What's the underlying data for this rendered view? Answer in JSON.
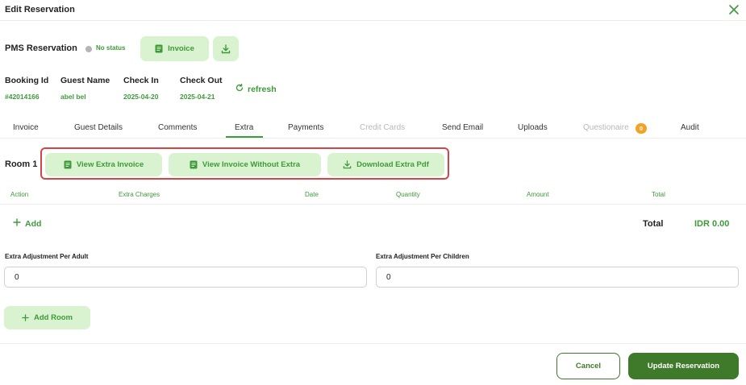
{
  "dialog": {
    "title": "Edit Reservation"
  },
  "reservation": {
    "title": "PMS Reservation",
    "status": "No status",
    "invoice_label": "Invoice",
    "booking_id_label": "Booking Id",
    "booking_id": "#42014166",
    "guest_name_label": "Guest Name",
    "guest_name": "abel bel",
    "check_in_label": "Check In",
    "check_in": "2025-04-20",
    "check_out_label": "Check Out",
    "check_out": "2025-04-21",
    "refresh_label": "refresh"
  },
  "tabs": [
    {
      "label": "Invoice"
    },
    {
      "label": "Guest Details"
    },
    {
      "label": "Comments"
    },
    {
      "label": "Extra",
      "active": true
    },
    {
      "label": "Payments"
    },
    {
      "label": "Credit Cards",
      "disabled": true
    },
    {
      "label": "Send Email"
    },
    {
      "label": "Uploads"
    },
    {
      "label": "Questionaire",
      "disabled": true,
      "badge": "0"
    },
    {
      "label": "Audit"
    }
  ],
  "room": {
    "label": "Room 1",
    "actions": {
      "view_extra_invoice": "View Extra Invoice",
      "view_invoice_without_extra": "View Invoice Without Extra",
      "download_extra_pdf": "Download Extra Pdf"
    },
    "table_headers": [
      "Action",
      "Extra Charges",
      "Date",
      "Quantity",
      "Amount",
      "Total"
    ],
    "add_label": "Add",
    "total_label": "Total",
    "total_value": "IDR 0.00",
    "adjust_adult_label": "Extra Adjustment Per Adult",
    "adjust_adult_value": "0",
    "adjust_children_label": "Extra Adjustment Per Children",
    "adjust_children_value": "0"
  },
  "add_room_label": "Add Room",
  "footer": {
    "cancel_label": "Cancel",
    "update_label": "Update Reservation"
  },
  "colors": {
    "accent": "#3f9a3b",
    "accent_dark": "#3f7a2a",
    "accent_light": "#d9f2cf",
    "highlight": "#d64545",
    "badge": "#f4a226"
  }
}
